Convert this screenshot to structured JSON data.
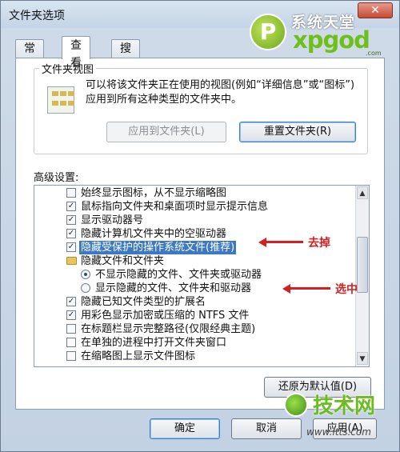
{
  "window": {
    "title": "文件夹选项",
    "close_label": "✕"
  },
  "logo": {
    "cn": "系统天堂",
    "en": "xpgod",
    "dotcom": ".com",
    "badge": "P"
  },
  "tabs": [
    {
      "label": "常规",
      "active": false
    },
    {
      "label": "查看",
      "active": true
    },
    {
      "label": "搜索",
      "active": false
    }
  ],
  "folder_view": {
    "group_label": "文件夹视图",
    "description": "可以将该文件夹正在使用的视图(例如“详细信息”或“图标”)应用到所有这种类型的文件夹中。",
    "apply_label": "应用到文件夹(L)",
    "reset_label": "重置文件夹(R)"
  },
  "advanced": {
    "label": "高级设置:",
    "items": [
      {
        "kind": "checkbox",
        "checked": false,
        "text": "始终显示图标，从不显示缩略图"
      },
      {
        "kind": "checkbox",
        "checked": true,
        "text": "鼠标指向文件夹和桌面项时显示提示信息"
      },
      {
        "kind": "checkbox",
        "checked": true,
        "text": "显示驱动器号"
      },
      {
        "kind": "checkbox",
        "checked": true,
        "text": "隐藏计算机文件夹中的空驱动器"
      },
      {
        "kind": "checkbox",
        "checked": true,
        "text": "隐藏受保护的操作系统文件(推荐)",
        "selected": true
      },
      {
        "kind": "folder",
        "text": "隐藏文件和文件夹"
      },
      {
        "kind": "radio",
        "checked": true,
        "text": "不显示隐藏的文件、文件夹或驱动器"
      },
      {
        "kind": "radio",
        "checked": false,
        "text": "显示隐藏的文件、文件夹和驱动器"
      },
      {
        "kind": "checkbox",
        "checked": true,
        "text": "隐藏已知文件类型的扩展名"
      },
      {
        "kind": "checkbox",
        "checked": true,
        "text": "用彩色显示加密或压缩的 NTFS 文件"
      },
      {
        "kind": "checkbox",
        "checked": false,
        "text": "在标题栏显示完整路径(仅限经典主题)"
      },
      {
        "kind": "checkbox",
        "checked": false,
        "text": "在单独的进程中打开文件夹窗口"
      },
      {
        "kind": "checkbox",
        "checked": false,
        "text": "在缩略图上显示文件图标"
      }
    ],
    "scroll_up": "▲",
    "scroll_down": "▼",
    "restore_label": "还原为默认值(D)"
  },
  "annotations": {
    "remove": "去掉",
    "select": "选中"
  },
  "footer": {
    "ok_label": "确定",
    "cancel_label": "取消",
    "apply_label": "应用(A)"
  },
  "watermark": {
    "main": "技术网",
    "url": "www.itts.com"
  },
  "colors": {
    "selection": "#3c78c4",
    "annotation": "#d42020",
    "brand_green": "#6cbc1f"
  }
}
